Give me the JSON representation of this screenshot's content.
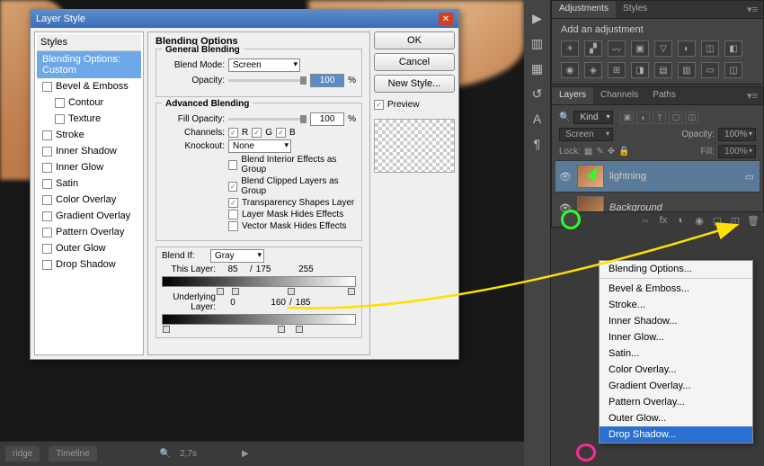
{
  "dialog": {
    "title": "Layer Style",
    "styles_header": "Styles",
    "styles_selected": "Blending Options: Custom",
    "styles_items": [
      "Bevel & Emboss",
      "Contour",
      "Texture",
      "Stroke",
      "Inner Shadow",
      "Inner Glow",
      "Satin",
      "Color Overlay",
      "Gradient Overlay",
      "Pattern Overlay",
      "Outer Glow",
      "Drop Shadow"
    ],
    "blending_options": "Blending Options",
    "general_blending": "General Blending",
    "blend_mode_lbl": "Blend Mode:",
    "blend_mode_val": "Screen",
    "opacity_lbl": "Opacity:",
    "opacity_val": "100",
    "pct": "%",
    "advanced_blending": "Advanced Blending",
    "fill_opacity_lbl": "Fill Opacity:",
    "fill_opacity_val": "100",
    "channels_lbl": "Channels:",
    "ch_r": "R",
    "ch_g": "G",
    "ch_b": "B",
    "knockout_lbl": "Knockout:",
    "knockout_val": "None",
    "adv_cb1": "Blend Interior Effects as Group",
    "adv_cb2": "Blend Clipped Layers as Group",
    "adv_cb3": "Transparency Shapes Layer",
    "adv_cb4": "Layer Mask Hides Effects",
    "adv_cb5": "Vector Mask Hides Effects",
    "blend_if_lbl": "Blend If:",
    "blend_if_val": "Gray",
    "this_layer_lbl": "This Layer:",
    "this_layer_v1": "85",
    "this_layer_sep": "/",
    "this_layer_v2": "175",
    "this_layer_v3": "255",
    "under_layer_lbl": "Underlying Layer:",
    "under_v1": "0",
    "under_v2": "160",
    "under_sep": "/",
    "under_v3": "185",
    "btn_ok": "OK",
    "btn_cancel": "Cancel",
    "btn_newstyle": "New Style...",
    "cb_preview": "Preview"
  },
  "bottom": {
    "tab1": "ridge",
    "tab2": "Timeline",
    "zoom": "2,7s"
  },
  "adjustments": {
    "tab1": "Adjustments",
    "tab2": "Styles",
    "title": "Add an adjustment"
  },
  "layers": {
    "tab1": "Layers",
    "tab2": "Channels",
    "tab3": "Paths",
    "kind": "Kind",
    "mode": "Screen",
    "opacity_lbl": "Opacity:",
    "opacity_val": "100%",
    "lock_lbl": "Lock:",
    "fill_lbl": "Fill:",
    "fill_val": "100%",
    "layer1": "lightning",
    "layer2": "Background"
  },
  "ctx": {
    "items": [
      "Blending Options...",
      "Bevel & Emboss...",
      "Stroke...",
      "Inner Shadow...",
      "Inner Glow...",
      "Satin...",
      "Color Overlay...",
      "Gradient Overlay...",
      "Pattern Overlay...",
      "Outer Glow...",
      "Drop Shadow..."
    ]
  }
}
